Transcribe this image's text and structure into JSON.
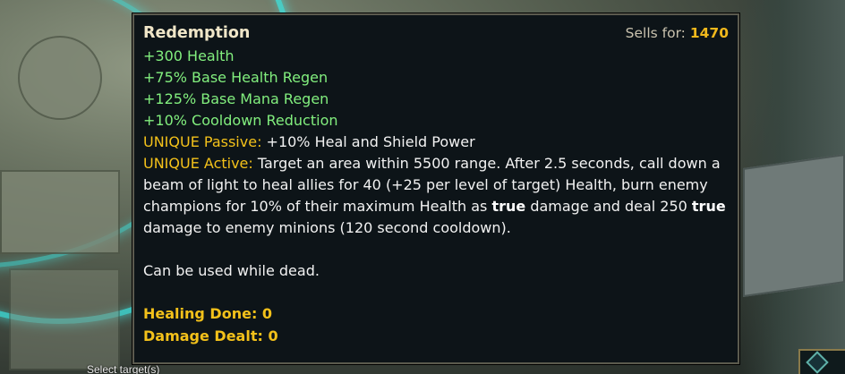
{
  "tooltip": {
    "item_name": "Redemption",
    "sells_label": "Sells for:",
    "sells_value": "1470",
    "stats": [
      "+300 Health",
      "+75% Base Health Regen",
      "+125% Base Mana Regen",
      "+10% Cooldown Reduction"
    ],
    "passive": {
      "label": "UNIQUE Passive:",
      "text": " +10% Heal and Shield Power"
    },
    "active": {
      "label": "UNIQUE Active:",
      "text_1": " Target an area within 5500 range. After 2.5 seconds, call down a beam of light to heal allies for 40 (+25 per level of target) Health, burn enemy champions for 10% of their maximum Health as ",
      "bold_1": "true",
      "text_2": " damage and deal 250 ",
      "bold_2": "true",
      "text_3": " damage to enemy minions (120 second cooldown)."
    },
    "note": "Can be used while dead.",
    "counters": [
      {
        "label": "Healing Done:",
        "value": "0"
      },
      {
        "label": "Damage Dealt:",
        "value": "0"
      }
    ]
  },
  "hud": {
    "select_target": "Select target(s)",
    "corner_icon": "ward-diamond-icon"
  },
  "colors": {
    "stat_green": "#82ef7e",
    "gold": "#f3c11a",
    "tooltip_bg": "#0d1418",
    "title": "#f0e6c8"
  }
}
